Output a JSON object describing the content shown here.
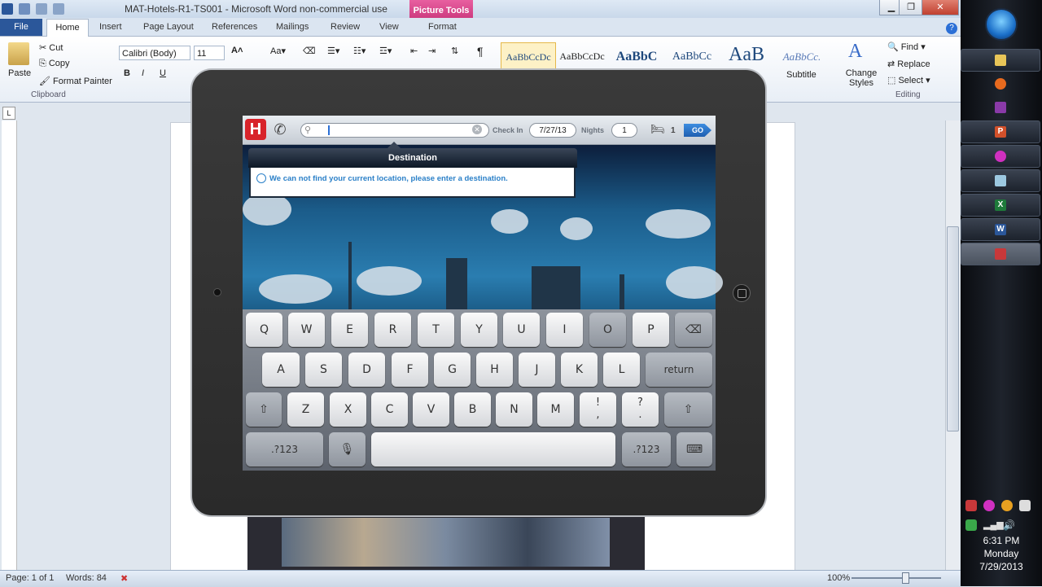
{
  "word": {
    "title": "MAT-Hotels-R1-TS001  -  Microsoft Word non-commercial use",
    "picture_tools": "Picture Tools",
    "tabs": [
      "File",
      "Home",
      "Insert",
      "Page Layout",
      "References",
      "Mailings",
      "Review",
      "View",
      "Format"
    ],
    "clipboard": {
      "paste": "Paste",
      "cut": "Cut",
      "copy": "Copy",
      "format_painter": "Format Painter",
      "label": "Clipboard"
    },
    "font": {
      "name": "Calibri (Body)",
      "size": "11"
    },
    "styles": [
      "AaBbCcDc",
      "AaBbCcDc",
      "AaBbC",
      "AaBbCc",
      "AaB",
      "AaBbCc."
    ],
    "style_subtitle": "Subtitle",
    "change_styles": "Change Styles",
    "editing": {
      "find": "Find",
      "replace": "Replace",
      "select": "Select",
      "label": "Editing"
    },
    "status": {
      "page": "Page: 1 of 1",
      "words": "Words: 84",
      "zoom": "100%"
    }
  },
  "ipad": {
    "search_placeholder": "",
    "checkin_label": "Check In",
    "checkin_date": "7/27/13",
    "nights_label": "Nights",
    "nights_value": "1",
    "rooms": "1",
    "go": "GO",
    "logo": "H",
    "destination_title": "Destination",
    "destination_message": "We can not find your current location, please enter a destination.",
    "keys_row1": [
      "Q",
      "W",
      "E",
      "R",
      "T",
      "Y",
      "U",
      "I",
      "O",
      "P"
    ],
    "keys_row2": [
      "A",
      "S",
      "D",
      "F",
      "G",
      "H",
      "J",
      "K",
      "L"
    ],
    "key_return": "return",
    "keys_row3": [
      "Z",
      "X",
      "C",
      "V",
      "B",
      "N",
      "M"
    ],
    "key_excl": "!\n,",
    "key_quest": "?\n.",
    "key_numbers": ".?123"
  },
  "taskbar": {
    "time": "6:31 PM",
    "day": "Monday",
    "date": "7/29/2013"
  },
  "colors": {
    "word_blue": "#2b579a",
    "picture_tools": "#d0408a",
    "go_blue": "#2a73c8",
    "logo_red": "#d8232a"
  }
}
